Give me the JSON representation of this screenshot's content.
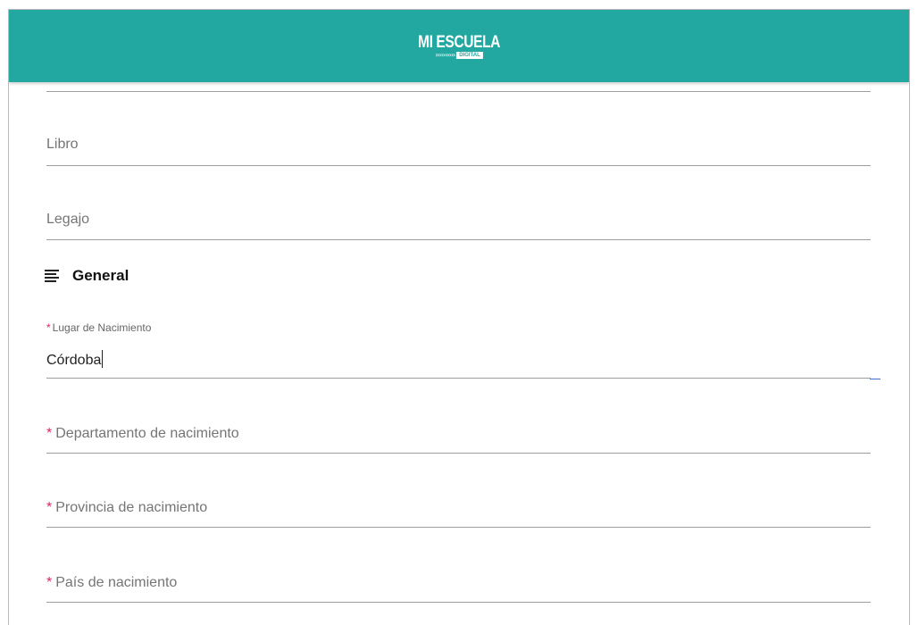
{
  "header": {
    "logo_text": "MI ESCUELA",
    "logo_subtext": "DIGITAL",
    "background_color": "#22a8a0"
  },
  "fields": {
    "libro": {
      "label": "Libro"
    },
    "legajo": {
      "label": "Legajo"
    }
  },
  "section_general": {
    "icon": "subject-lines-icon",
    "title": "General"
  },
  "general_fields": {
    "lugar_nacimiento": {
      "required_mark": "*",
      "label": "Lugar de Nacimiento",
      "value": "Córdoba"
    },
    "departamento": {
      "required_mark": "*",
      "label": "Departamento de nacimiento"
    },
    "provincia": {
      "required_mark": "*",
      "label": "Provincia de nacimiento"
    },
    "pais": {
      "required_mark": "*",
      "label": "País de nacimiento"
    }
  },
  "colors": {
    "required": "#e0245e",
    "focus": "#3f6fd1"
  }
}
